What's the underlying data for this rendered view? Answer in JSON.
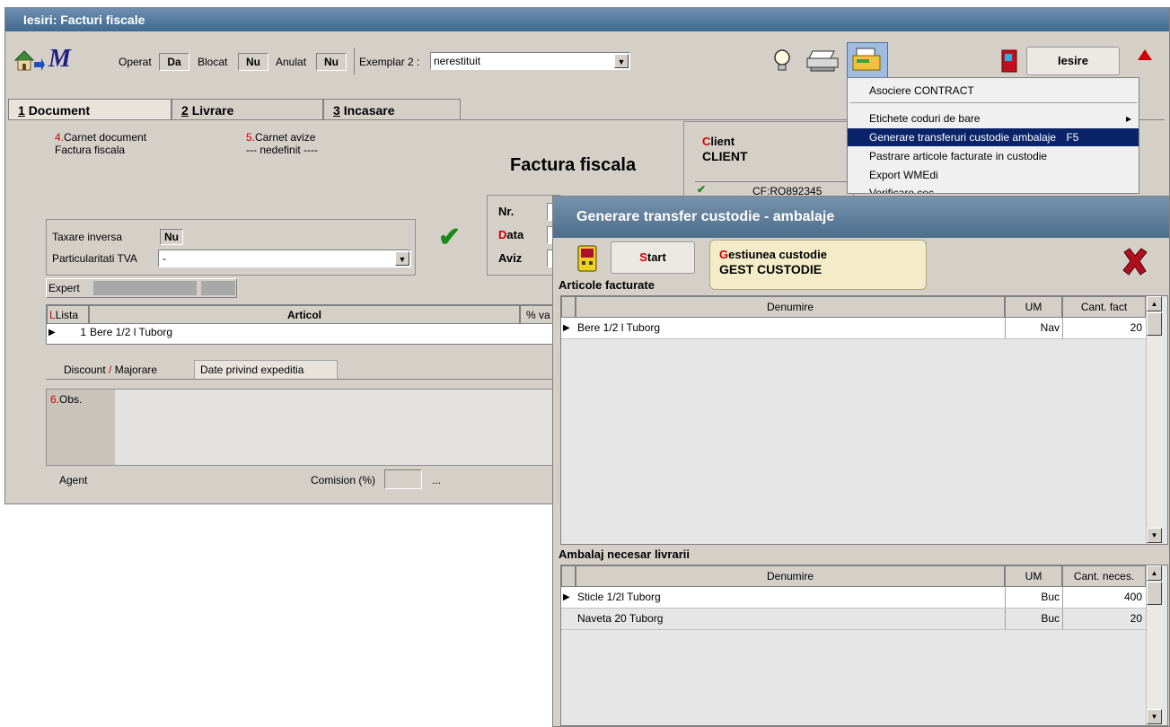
{
  "window": {
    "title": "Iesiri: Facturi fiscale",
    "toolbar": {
      "operat_label": "Operat",
      "operat_value": "Da",
      "blocat_label": "Blocat",
      "blocat_value": "Nu",
      "anulat_label": "Anulat",
      "anulat_value": "Nu",
      "exemplar_label": "Exemplar 2 :",
      "exemplar_value": "nerestituit",
      "iesire_label": "Iesire"
    },
    "tabs": [
      {
        "num": "1",
        "label": "Document"
      },
      {
        "num": "2",
        "label": "Livrare"
      },
      {
        "num": "3",
        "label": "Incasare"
      }
    ],
    "document": {
      "carnet_num": "4.",
      "carnet_label": "Carnet document",
      "carnet_value": "Factura fiscala",
      "avize_num": "5.",
      "avize_label": "Carnet avize",
      "avize_value": "--- nedefinit ----",
      "heading": "Factura fiscala",
      "client_initial": "C",
      "client_rest": "lient",
      "client_value": "CLIENT",
      "cf_value": "CF:RO892345",
      "nr_label": "Nr.",
      "data_initial": "D",
      "data_rest": "ata",
      "aviz_label": "Aviz",
      "taxare_label": "Taxare inversa",
      "taxare_value": "Nu",
      "particularitati_label": "Particularitati TVA",
      "particularitati_value": "-",
      "expert_label": "Expert",
      "grid_lista": "Lista",
      "grid_articol": "Articol",
      "grid_pct": "% va",
      "row_num": "1",
      "row_name": "Bere 1/2 l Tuborg",
      "subtab_discount": "Discount",
      "subtab_slash": "/",
      "subtab_majorare": "Majorare",
      "subtab_expeditie": "Date privind expeditia",
      "obs_num": "6.",
      "obs_label": "Obs.",
      "agent_label": "Agent",
      "comision_label": "Comision (%)",
      "ellipsis": "..."
    }
  },
  "menu": {
    "items": [
      {
        "label": "Asociere CONTRACT"
      },
      {
        "label": "Etichete coduri de bare",
        "submenu": "▸"
      },
      {
        "label": "Generare transferuri custodie ambalaje",
        "shortcut": "F5"
      },
      {
        "label": "Pastrare articole facturate in custodie"
      },
      {
        "label": "Export WMEdi"
      },
      {
        "label": "Verificare cec"
      }
    ]
  },
  "dialog": {
    "title": "Generare transfer custodie - ambalaje",
    "start_initial": "S",
    "start_rest": "tart",
    "gest_initial": "G",
    "gest_rest": "estiunea custodie",
    "gest_value": "GEST CUSTODIE",
    "sec1_title": "Articole facturate",
    "sec1_columns": {
      "denumire": "Denumire",
      "um": "UM",
      "cant": "Cant. fact"
    },
    "sec1_rows": [
      {
        "denumire": "Bere 1/2 l Tuborg",
        "um": "Nav",
        "cant": "20"
      }
    ],
    "sec2_title": "Ambalaj necesar livrarii",
    "sec2_columns": {
      "denumire": "Denumire",
      "um": "UM",
      "cant": "Cant. neces."
    },
    "sec2_rows": [
      {
        "denumire": "Sticle 1/2l Tuborg",
        "um": "Buc",
        "cant": "400"
      },
      {
        "denumire": "Naveta 20 Tuborg",
        "um": "Buc",
        "cant": "20"
      }
    ]
  },
  "colors": {
    "title_bar": "#4a7196",
    "menu_highlight": "#0a246a",
    "accent_red": "#d00000",
    "check_green": "#1a8a1a"
  },
  "icons": [
    "home-arrow-icon",
    "wme-logo-icon",
    "lightbulb-icon",
    "printer-icon",
    "fax-icon",
    "exit-door-icon",
    "arrow-up-icon",
    "start-device-icon",
    "close-x-icon",
    "checkmark-icon"
  ]
}
